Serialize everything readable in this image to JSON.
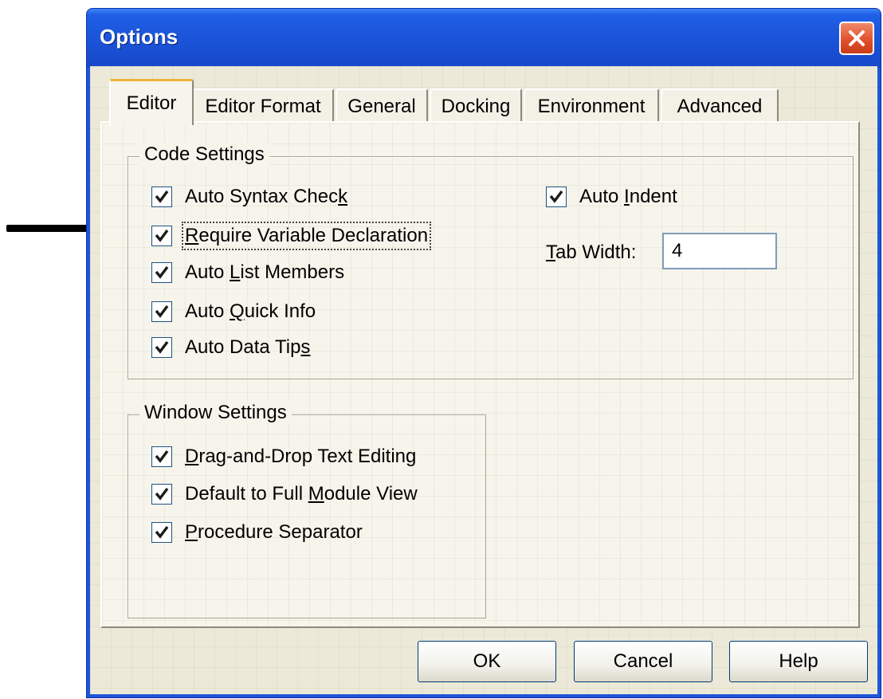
{
  "window": {
    "title": "Options"
  },
  "tabs": [
    {
      "label": "Editor",
      "active": true
    },
    {
      "label": "Editor Format",
      "active": false
    },
    {
      "label": "General",
      "active": false
    },
    {
      "label": "Docking",
      "active": false
    },
    {
      "label": "Environment",
      "active": false
    },
    {
      "label": "Advanced",
      "active": false
    }
  ],
  "code_settings": {
    "title": "Code Settings",
    "auto_syntax_check": {
      "pre": "Auto Syntax Chec",
      "key": "k",
      "post": "",
      "checked": true
    },
    "require_var_decl": {
      "pre": "",
      "key": "R",
      "post": "equire Variable Declaration",
      "checked": true
    },
    "auto_list_members": {
      "pre": "Auto ",
      "key": "L",
      "post": "ist Members",
      "checked": true
    },
    "auto_quick_info": {
      "pre": "Auto ",
      "key": "Q",
      "post": "uick Info",
      "checked": true
    },
    "auto_data_tips": {
      "pre": "Auto Data Tip",
      "key": "s",
      "post": "",
      "checked": true
    },
    "auto_indent": {
      "pre": "Auto ",
      "key": "I",
      "post": "ndent",
      "checked": true
    },
    "tab_width": {
      "key": "T",
      "post": "ab Width:",
      "value": "4"
    }
  },
  "window_settings": {
    "title": "Window Settings",
    "drag_drop": {
      "pre": "",
      "key": "D",
      "post": "rag-and-Drop Text Editing",
      "checked": true
    },
    "full_module": {
      "pre": "Default to Full ",
      "key": "M",
      "post": "odule View",
      "checked": true
    },
    "proc_separator": {
      "pre": "",
      "key": "P",
      "post": "rocedure Separator",
      "checked": true
    }
  },
  "buttons": {
    "ok": "OK",
    "cancel": "Cancel",
    "help": "Help"
  },
  "colors": {
    "title_bar": "#1a52d6",
    "dialog_face": "#ece9d8",
    "close_button": "#e2512d",
    "active_tab_accent": "#f0b23a"
  }
}
